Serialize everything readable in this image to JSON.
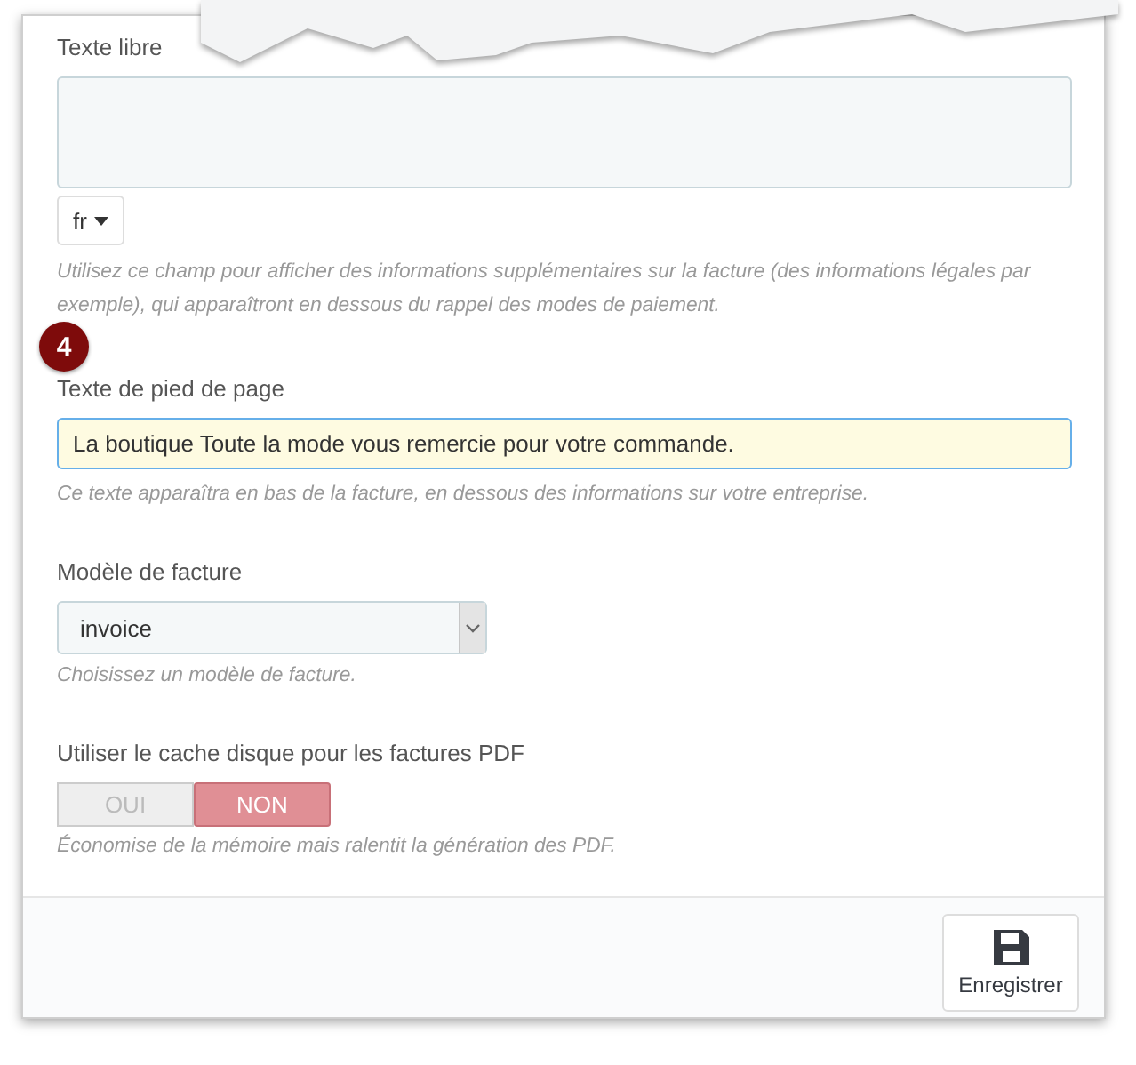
{
  "free_text": {
    "label": "Texte libre",
    "language": "fr",
    "help": "Utilisez ce champ pour afficher des informations supplémentaires sur la facture (des informations légales par exemple), qui apparaîtront en dessous du rappel des modes de paiement."
  },
  "step_badge": "4",
  "footer_text": {
    "label": "Texte de pied de page",
    "value": "La boutique Toute la mode vous remercie pour votre commande.",
    "help": "Ce texte apparaîtra en bas de la facture, en dessous des informations sur votre entreprise."
  },
  "invoice_template": {
    "label": "Modèle de facture",
    "value": "invoice",
    "help": "Choisissez un modèle de facture."
  },
  "pdf_cache": {
    "label": "Utiliser le cache disque pour les factures PDF",
    "options": [
      {
        "label": "OUI",
        "selected": false
      },
      {
        "label": "NON",
        "selected": true
      }
    ],
    "help": "Économise de la mémoire mais ralentit la génération des PDF."
  },
  "save_button": "Enregistrer"
}
